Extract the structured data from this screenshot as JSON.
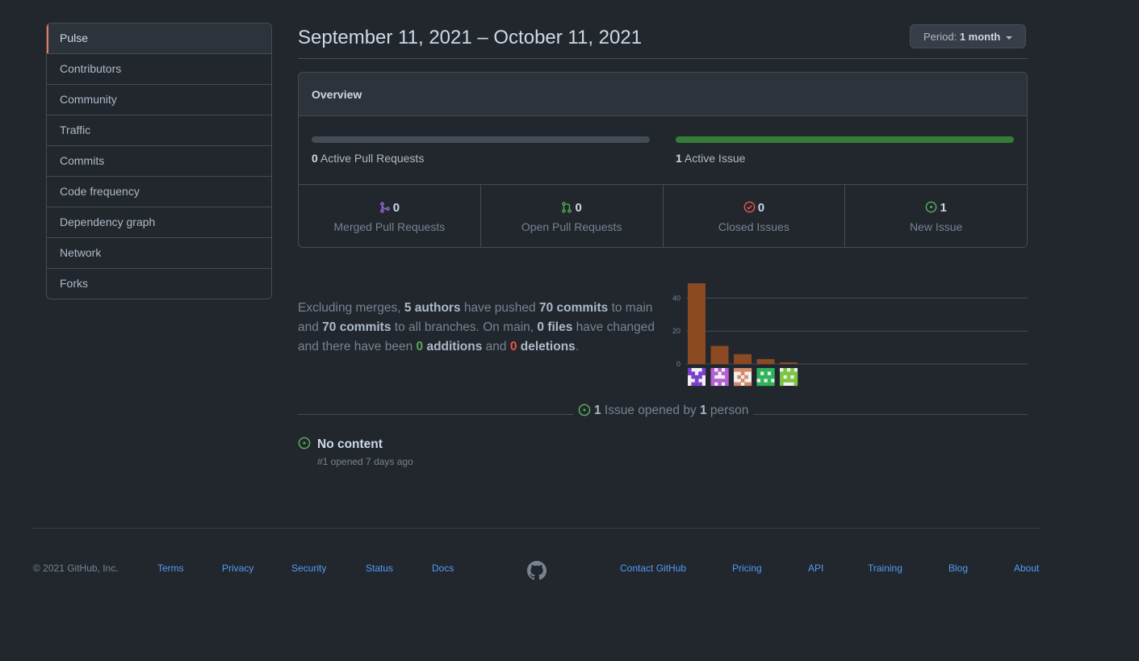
{
  "sidebar": {
    "items": [
      {
        "label": "Pulse",
        "selected": true
      },
      {
        "label": "Contributors"
      },
      {
        "label": "Community"
      },
      {
        "label": "Traffic"
      },
      {
        "label": "Commits"
      },
      {
        "label": "Code frequency"
      },
      {
        "label": "Dependency graph"
      },
      {
        "label": "Network"
      },
      {
        "label": "Forks"
      }
    ]
  },
  "header": {
    "date_range": "September 11, 2021 – October 11, 2021",
    "period_prefix": "Period:",
    "period_value": "1 month"
  },
  "overview": {
    "title": "Overview",
    "pull_requests": {
      "count": "0",
      "label": "Active Pull Requests",
      "fill_fraction": 0
    },
    "issues": {
      "count": "1",
      "label": "Active Issue",
      "fill_fraction": 1
    },
    "stats": [
      {
        "icon": "merged-pr-icon",
        "count": "0",
        "label": "Merged Pull Requests",
        "color": "#986ee2"
      },
      {
        "icon": "open-pr-icon",
        "count": "0",
        "label": "Open Pull Requests",
        "color": "#57ab5a"
      },
      {
        "icon": "closed-issue-icon",
        "count": "0",
        "label": "Closed Issues",
        "color": "#e5534b"
      },
      {
        "icon": "new-issue-icon",
        "count": "1",
        "label": "New Issue",
        "color": "#57ab5a"
      }
    ]
  },
  "summary": {
    "t1": "Excluding merges, ",
    "authors": "5 authors",
    "t2": " have pushed ",
    "commits_main": "70 commits",
    "t3": " to main and ",
    "commits_all": "70 commits",
    "t4": " to all branches. On main, ",
    "files": "0 files",
    "t5": " have changed and there have been ",
    "additions_num": "0",
    "additions_word": " additions",
    "t6": " and ",
    "deletions_num": "0",
    "deletions_word": " deletions",
    "t7": "."
  },
  "chart_data": {
    "type": "bar",
    "categories": [
      "author-1",
      "author-2",
      "author-3",
      "author-4",
      "author-5"
    ],
    "values": [
      49,
      11,
      6,
      3,
      1
    ],
    "yticks": [
      0,
      20,
      40
    ],
    "ylim": [
      0,
      50
    ],
    "bar_color": "#8b4a22",
    "avatar_colors": [
      "#7b3fd0",
      "#b45fd6",
      "#d28a6a",
      "#2fb35a",
      "#7cc442"
    ]
  },
  "issues": {
    "summary_count": "1",
    "summary_t1": " Issue opened by ",
    "summary_people": "1",
    "summary_t2": " person",
    "items": [
      {
        "title": "No content",
        "meta": "#1 opened 7 days ago"
      }
    ]
  },
  "footer": {
    "copyright": "© 2021 GitHub, Inc.",
    "links_left": [
      "Terms",
      "Privacy",
      "Security",
      "Status",
      "Docs"
    ],
    "links_right": [
      "Contact GitHub",
      "Pricing",
      "API",
      "Training",
      "Blog",
      "About"
    ]
  }
}
